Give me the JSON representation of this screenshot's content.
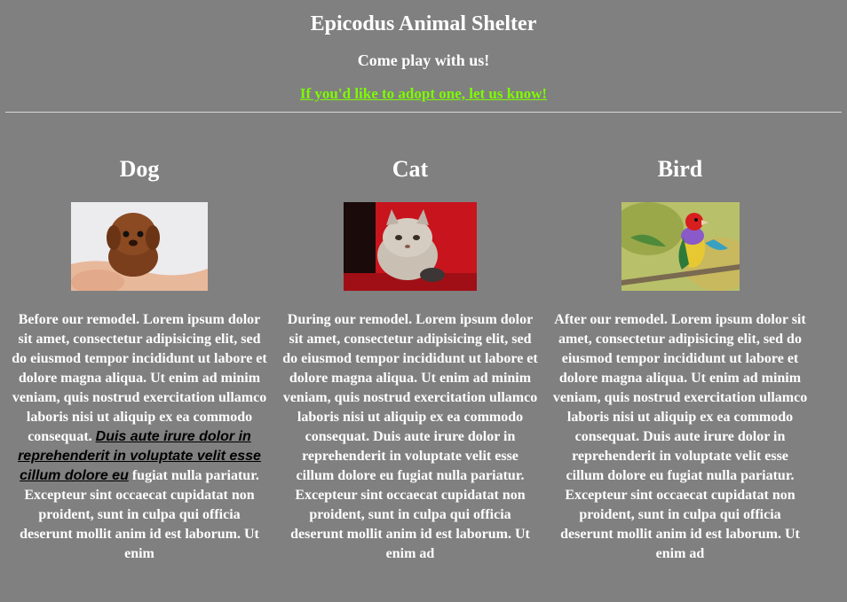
{
  "header": {
    "title": "Epicodus Animal Shelter",
    "tagline": "Come play with us!",
    "adopt_link": "If you'd like to adopt one, let us know!"
  },
  "colors": {
    "background": "#808080",
    "text": "#ffffff",
    "link": "#7cfc00"
  },
  "animals": [
    {
      "name": "Dog",
      "photo": "puppy-photo",
      "text_before": "Before our remodel. Lorem ipsum dolor sit amet, consectetur adipisicing elit, sed do eiusmod tempor incididunt ut labore et dolore magna aliqua. Ut enim ad minim veniam, quis nostrud exercitation ullamco laboris nisi ut aliquip ex ea commodo consequat.",
      "link_text": "Duis aute irure dolor in reprehenderit in voluptate velit esse cillum dolore eu",
      "text_after": "fugiat nulla pariatur. Excepteur sint occaecat cupidatat non proident, sunt in culpa qui officia deserunt mollit anim id est laborum. Ut enim"
    },
    {
      "name": "Cat",
      "photo": "kitten-photo",
      "text": "During our remodel. Lorem ipsum dolor sit amet, consectetur adipisicing elit, sed do eiusmod tempor incididunt ut labore et dolore magna aliqua. Ut enim ad minim veniam, quis nostrud exercitation ullamco laboris nisi ut aliquip ex ea commodo consequat. Duis aute irure dolor in reprehenderit in voluptate velit esse cillum dolore eu fugiat nulla pariatur. Excepteur sint occaecat cupidatat non proident, sunt in culpa qui officia deserunt mollit anim id est laborum. Ut enim ad"
    },
    {
      "name": "Bird",
      "photo": "finch-photo",
      "text": "After our remodel. Lorem ipsum dolor sit amet, consectetur adipisicing elit, sed do eiusmod tempor incididunt ut labore et dolore magna aliqua. Ut enim ad minim veniam, quis nostrud exercitation ullamco laboris nisi ut aliquip ex ea commodo consequat. Duis aute irure dolor in reprehenderit in voluptate velit esse cillum dolore eu fugiat nulla pariatur. Excepteur sint occaecat cupidatat non proident, sunt in culpa qui officia deserunt mollit anim id est laborum. Ut enim ad"
    }
  ]
}
